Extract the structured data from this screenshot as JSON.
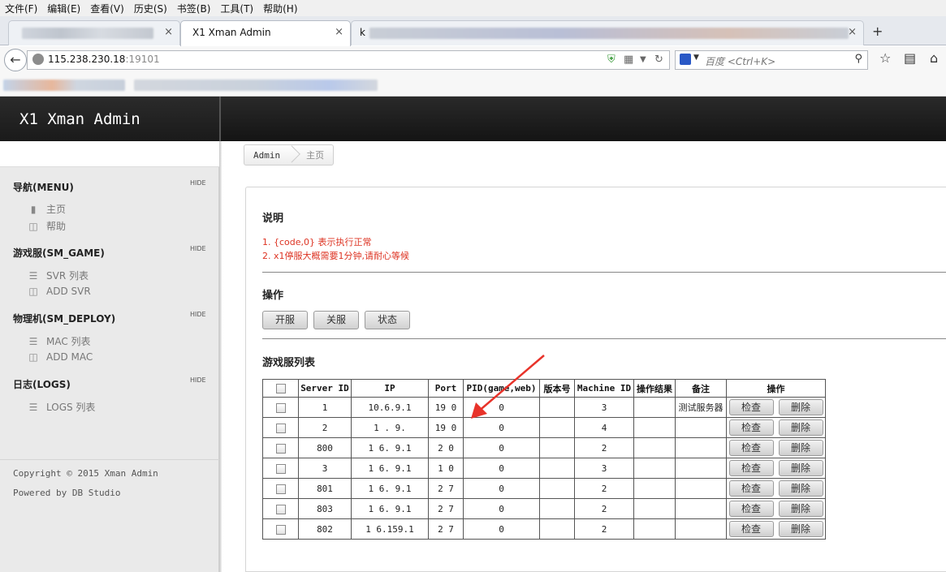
{
  "menu": [
    "文件(F)",
    "编辑(E)",
    "查看(V)",
    "历史(S)",
    "书签(B)",
    "工具(T)",
    "帮助(H)"
  ],
  "tabs": {
    "active_title": "X1 Xman Admin",
    "second_title_prefix": "k",
    "close": "×",
    "new_tab": "+"
  },
  "address": {
    "host": "115.238.230.18",
    "port": ":19101"
  },
  "search": {
    "placeholder": "百度 <Ctrl+K>"
  },
  "brand": "X1 Xman Admin",
  "sidebar": {
    "hide_label": "HIDE",
    "sections": [
      {
        "title": "导航(MENU)",
        "items": [
          {
            "icon": "bookmark-icon",
            "label": "主页"
          },
          {
            "icon": "help-doc-icon",
            "label": "帮助"
          }
        ]
      },
      {
        "title": "游戏服(SM_GAME)",
        "items": [
          {
            "icon": "list-icon",
            "label": "SVR 列表"
          },
          {
            "icon": "add-doc-icon",
            "label": "ADD SVR"
          }
        ]
      },
      {
        "title": "物理机(SM_DEPLOY)",
        "items": [
          {
            "icon": "list-icon",
            "label": "MAC 列表"
          },
          {
            "icon": "add-doc-icon",
            "label": "ADD MAC"
          }
        ]
      },
      {
        "title": "日志(LOGS)",
        "items": [
          {
            "icon": "list-icon",
            "label": "LOGS 列表"
          }
        ]
      }
    ],
    "copyright": "Copyright © 2015 Xman Admin",
    "powered": "Powered by DB Studio"
  },
  "breadcrumb": [
    "Admin",
    "主页"
  ],
  "main": {
    "notes_title": "说明",
    "notes": [
      "1. {code,0} 表示执行正常",
      "2. x1停服大概需要1分钟,请耐心等候"
    ],
    "ops_title": "操作",
    "buttons": [
      "开服",
      "关服",
      "状态"
    ],
    "list_title": "游戏服列表"
  },
  "table": {
    "headers": [
      "Server ID",
      "IP",
      "Port",
      "PID(game,web)",
      "版本号",
      "Machine ID",
      "操作结果",
      "备注",
      "操作"
    ],
    "check_label": "检查",
    "delete_label": "删除",
    "rows": [
      {
        "server_id": "1",
        "ip": "10.6.9.1",
        "port": "19 0",
        "pid": "0",
        "version": "",
        "machine_id": "3",
        "result": "",
        "remark": "测试服务器"
      },
      {
        "server_id": "2",
        "ip": "1 . 9.",
        "port": "19 0",
        "pid": "0",
        "version": "",
        "machine_id": "4",
        "result": "",
        "remark": ""
      },
      {
        "server_id": "800",
        "ip": "1 6. 9.1",
        "port": "2 0",
        "pid": "0",
        "version": "",
        "machine_id": "2",
        "result": "",
        "remark": ""
      },
      {
        "server_id": "3",
        "ip": "1 6. 9.1",
        "port": "1 0",
        "pid": "0",
        "version": "",
        "machine_id": "3",
        "result": "",
        "remark": ""
      },
      {
        "server_id": "801",
        "ip": "1 6. 9.1",
        "port": "2 7",
        "pid": "0",
        "version": "",
        "machine_id": "2",
        "result": "",
        "remark": ""
      },
      {
        "server_id": "803",
        "ip": "1 6. 9.1",
        "port": "2 7",
        "pid": "0",
        "version": "",
        "machine_id": "2",
        "result": "",
        "remark": ""
      },
      {
        "server_id": "802",
        "ip": "1 6.159.1",
        "port": "2 7",
        "pid": "0",
        "version": "",
        "machine_id": "2",
        "result": "",
        "remark": ""
      }
    ]
  },
  "colors": {
    "note_red": "#dd3322",
    "arrow_red": "#e8332a",
    "header_dark": "#1a1a1a"
  }
}
